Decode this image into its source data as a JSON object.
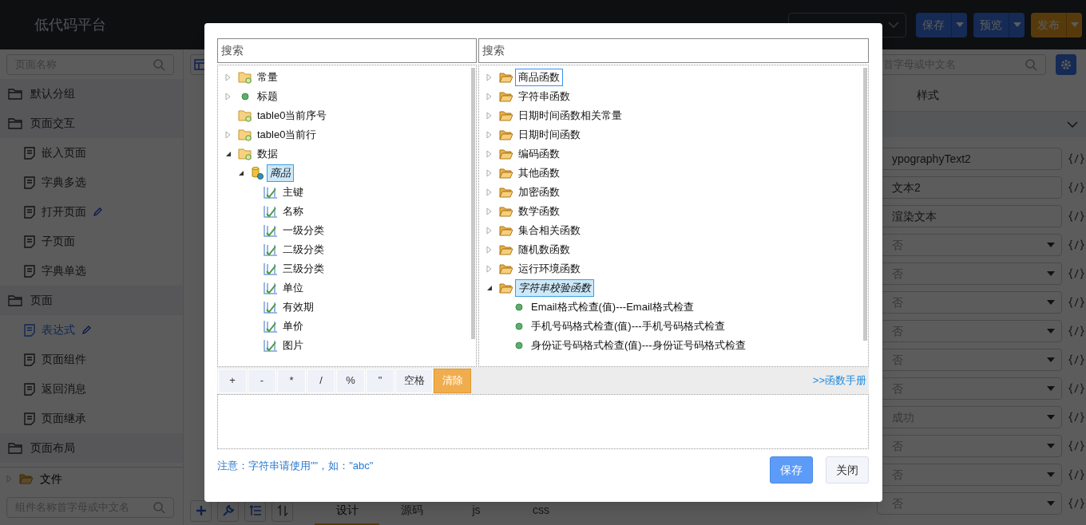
{
  "header": {
    "title": "低代码平台",
    "buttons": [
      {
        "label": "保存",
        "kind": "primary"
      },
      {
        "label": "预览",
        "kind": "primary"
      },
      {
        "label": "发布",
        "kind": "warning"
      }
    ]
  },
  "left_sidebar": {
    "search_placeholder": "页面名称",
    "groups": [
      {
        "label": "默认分组"
      },
      {
        "label": "页面交互",
        "children": [
          {
            "label": "嵌入页面",
            "selected": false,
            "editable": false
          },
          {
            "label": "字典多选",
            "selected": false,
            "editable": false
          },
          {
            "label": "打开页面",
            "selected": false,
            "editable": true
          },
          {
            "label": "子页面",
            "selected": false,
            "editable": false
          },
          {
            "label": "字典单选",
            "selected": false,
            "editable": false
          }
        ]
      },
      {
        "label": "页面",
        "children": [
          {
            "label": "表达式",
            "selected": true,
            "editable": true
          },
          {
            "label": "页面组件",
            "selected": false,
            "editable": false
          },
          {
            "label": "返回消息",
            "selected": false,
            "editable": false
          },
          {
            "label": "页面继承",
            "selected": false,
            "editable": false
          }
        ]
      },
      {
        "label": "页面布局"
      }
    ],
    "file_tree": {
      "label": "文件",
      "expanded": false
    },
    "component_search_placeholder": "组件名称首字母或中文名"
  },
  "editor_tabs": [
    {
      "label": "设计",
      "selected": true
    },
    {
      "label": "源码",
      "selected": false
    },
    {
      "label": "js",
      "selected": false
    },
    {
      "label": "css",
      "selected": false
    }
  ],
  "right_panel": {
    "search_placeholder": "首字母或中文名",
    "tabs": [
      "样式"
    ],
    "properties": [
      {
        "kind": "text",
        "value": "ypographyText2"
      },
      {
        "kind": "text",
        "value": "文本2"
      },
      {
        "kind": "text",
        "value": "渲染文本"
      },
      {
        "kind": "select",
        "value": "否"
      },
      {
        "kind": "select",
        "value": "否"
      },
      {
        "kind": "select",
        "value": "否"
      },
      {
        "kind": "select",
        "value": "否"
      },
      {
        "kind": "select",
        "value": "否"
      },
      {
        "kind": "select",
        "value": "否"
      },
      {
        "kind": "select",
        "value": "成功"
      },
      {
        "kind": "select",
        "value": "否"
      },
      {
        "kind": "select",
        "value": "否"
      },
      {
        "kind": "select",
        "value": "否"
      }
    ]
  },
  "modal": {
    "left_search_placeholder": "搜索",
    "right_search_placeholder": "搜索",
    "variable_tree": [
      {
        "label": "常量",
        "kind": "folder-var",
        "expanded": false,
        "selected": false
      },
      {
        "label": "标题",
        "kind": "dot",
        "expanded": false,
        "selected": false
      },
      {
        "label": "table0当前序号",
        "kind": "folder-var",
        "selected": false
      },
      {
        "label": "table0当前行",
        "kind": "folder-var",
        "expanded": false,
        "selected": false
      },
      {
        "label": "数据",
        "kind": "folder-var",
        "expanded": true,
        "selected": false,
        "children": [
          {
            "label": "商品",
            "kind": "database",
            "expanded": true,
            "selected": true,
            "children": [
              {
                "label": "主键",
                "kind": "field",
                "selected": false
              },
              {
                "label": "名称",
                "kind": "field",
                "selected": false
              },
              {
                "label": "一级分类",
                "kind": "field",
                "selected": false
              },
              {
                "label": "二级分类",
                "kind": "field",
                "selected": false
              },
              {
                "label": "三级分类",
                "kind": "field",
                "selected": false
              },
              {
                "label": "单位",
                "kind": "field",
                "selected": false
              },
              {
                "label": "有效期",
                "kind": "field",
                "selected": false
              },
              {
                "label": "单价",
                "kind": "field",
                "selected": false
              },
              {
                "label": "图片",
                "kind": "field",
                "selected": false
              }
            ]
          }
        ]
      }
    ],
    "function_tree": [
      {
        "label": "商品函数",
        "kind": "folder",
        "expanded": false,
        "selected": false,
        "focused": true
      },
      {
        "label": "字符串函数",
        "kind": "folder",
        "expanded": false,
        "selected": false,
        "focused": false
      },
      {
        "label": "日期时间函数相关常量",
        "kind": "folder",
        "expanded": false,
        "selected": false,
        "focused": false
      },
      {
        "label": "日期时间函数",
        "kind": "folder",
        "expanded": false,
        "selected": false,
        "focused": false
      },
      {
        "label": "编码函数",
        "kind": "folder",
        "expanded": false,
        "selected": false,
        "focused": false
      },
      {
        "label": "其他函数",
        "kind": "folder",
        "expanded": false,
        "selected": false,
        "focused": false
      },
      {
        "label": "加密函数",
        "kind": "folder",
        "expanded": false,
        "selected": false,
        "focused": false
      },
      {
        "label": "数学函数",
        "kind": "folder",
        "expanded": false,
        "selected": false,
        "focused": false
      },
      {
        "label": "集合相关函数",
        "kind": "folder",
        "expanded": false,
        "selected": false,
        "focused": false
      },
      {
        "label": "随机数函数",
        "kind": "folder",
        "expanded": false,
        "selected": false,
        "focused": false
      },
      {
        "label": "运行环境函数",
        "kind": "folder",
        "expanded": false,
        "selected": false,
        "focused": false
      },
      {
        "label": "字符串校验函数",
        "kind": "folder",
        "expanded": true,
        "selected": true,
        "focused": false,
        "children": [
          {
            "label": "Email格式检查(值)---Email格式检查",
            "kind": "dot",
            "selected": false,
            "focused": false
          },
          {
            "label": "手机号码格式检查(值)---手机号码格式检查",
            "kind": "dot",
            "selected": false,
            "focused": false
          },
          {
            "label": "身份证号码格式检查(值)---身份证号码格式检查",
            "kind": "dot",
            "selected": false,
            "focused": false
          }
        ]
      }
    ],
    "operators": [
      {
        "label": "+",
        "kind": "operator"
      },
      {
        "label": "-",
        "kind": "operator"
      },
      {
        "label": "*",
        "kind": "operator"
      },
      {
        "label": "/",
        "kind": "operator"
      },
      {
        "label": "%",
        "kind": "operator"
      },
      {
        "label": "\"",
        "kind": "operator"
      },
      {
        "label": "空格",
        "kind": "operator"
      },
      {
        "label": "清除",
        "kind": "clear"
      }
    ],
    "manual_link": ">>函数手册",
    "note": "注意：字符串请使用\"\"，如：\"abc\"",
    "buttons": [
      {
        "label": "保存",
        "kind": "primary"
      },
      {
        "label": "关闭",
        "kind": "default"
      }
    ]
  }
}
